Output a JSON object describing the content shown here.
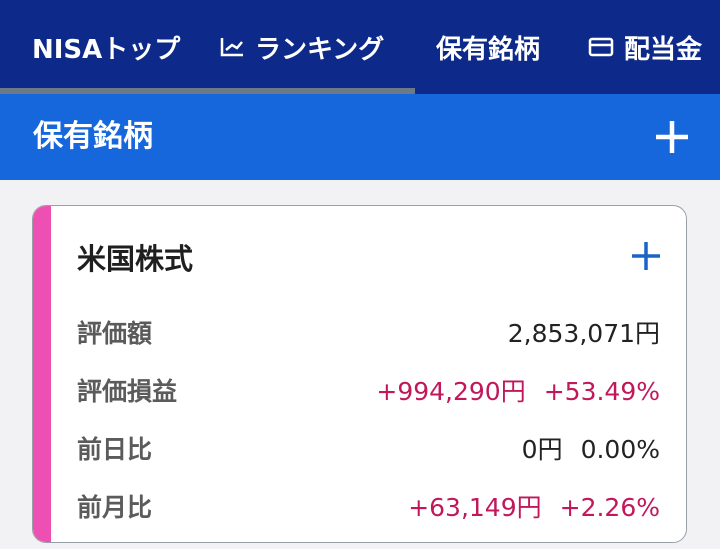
{
  "tabs": [
    {
      "label": "NISAトップ",
      "icon": ""
    },
    {
      "label": "ランキング",
      "icon": "chart-icon"
    },
    {
      "label": "保有銘柄",
      "icon": ""
    },
    {
      "label": "配当金",
      "icon": "card-icon"
    }
  ],
  "header": {
    "title": "保有銘柄",
    "add_icon": "plus-icon"
  },
  "card": {
    "title": "米国株式",
    "accent_color": "#ee4fb3",
    "rows": [
      {
        "label": "評価額",
        "value": "2,853,071円",
        "percent": ""
      },
      {
        "label": "評価損益",
        "value": "+994,290円",
        "percent": "+53.49%"
      },
      {
        "label": "前日比",
        "value": "0円",
        "percent": "0.00%"
      },
      {
        "label": "前月比",
        "value": "+63,149円",
        "percent": "+2.26%"
      }
    ]
  },
  "colors": {
    "nav_bg": "#0d2a8a",
    "header_bg": "#1667dc",
    "positive": "#c2185b",
    "accent": "#ee4fb3"
  }
}
